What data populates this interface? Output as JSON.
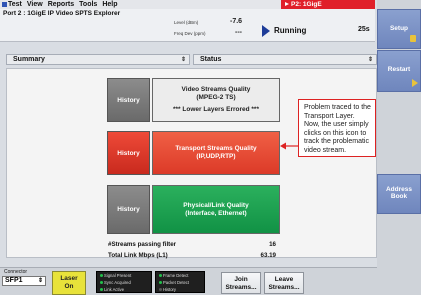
{
  "menubar": {
    "items": [
      "Test",
      "View",
      "Reports",
      "Tools",
      "Help"
    ],
    "port_tab": "P2: 1GigE"
  },
  "header": {
    "title": "Port 2 : 1GigE IP Video SPTS Explorer",
    "level_label": "Level (dBm)",
    "level_value": "-7.6",
    "freq_label": "Freq Dev (ppm)",
    "freq_value": "---",
    "status": "Running",
    "time": "25s"
  },
  "side_panel": {
    "setup": "Setup",
    "restart": "Restart",
    "address_book_line1": "Address",
    "address_book_line2": "Book"
  },
  "dropdowns": {
    "left": "Summary",
    "right": "Status"
  },
  "layers": [
    {
      "history": "History",
      "line1": "Video Streams Quality",
      "line2": "(MPEG-2 TS)",
      "line3": "*** Lower Layers Errored ***"
    },
    {
      "history": "History",
      "line1": "Transport Streams Quality",
      "line2": "(IP,UDP,RTP)"
    },
    {
      "history": "History",
      "line1": "Physical/Link Quality",
      "line2": "(Interface, Ethernet)"
    }
  ],
  "callout": "Problem traced to the Transport Layer. Now, the user simply clicks on this icon to track the problematic video stream.",
  "stats": {
    "streams_label": "#Streams passing filter",
    "streams_value": "16",
    "link_label": "Total Link Mbps (L1)",
    "link_value": "63.19"
  },
  "bottom": {
    "connector_label": "Connector",
    "connector_value": "SFP1",
    "laser_line1": "Laser",
    "laser_line2": "On",
    "led1": [
      "Signal Present",
      "Sync Acquired",
      "Link Active"
    ],
    "led2": [
      "Frame Detect",
      "Packet Detect",
      "History"
    ],
    "join_line1": "Join",
    "join_line2": "Streams...",
    "leave_line1": "Leave",
    "leave_line2": "Streams..."
  },
  "colors": {
    "accent": "#e0202a",
    "layer_red": "#dc3a28",
    "layer_green": "#119245",
    "side_button": "#7a90c6"
  }
}
